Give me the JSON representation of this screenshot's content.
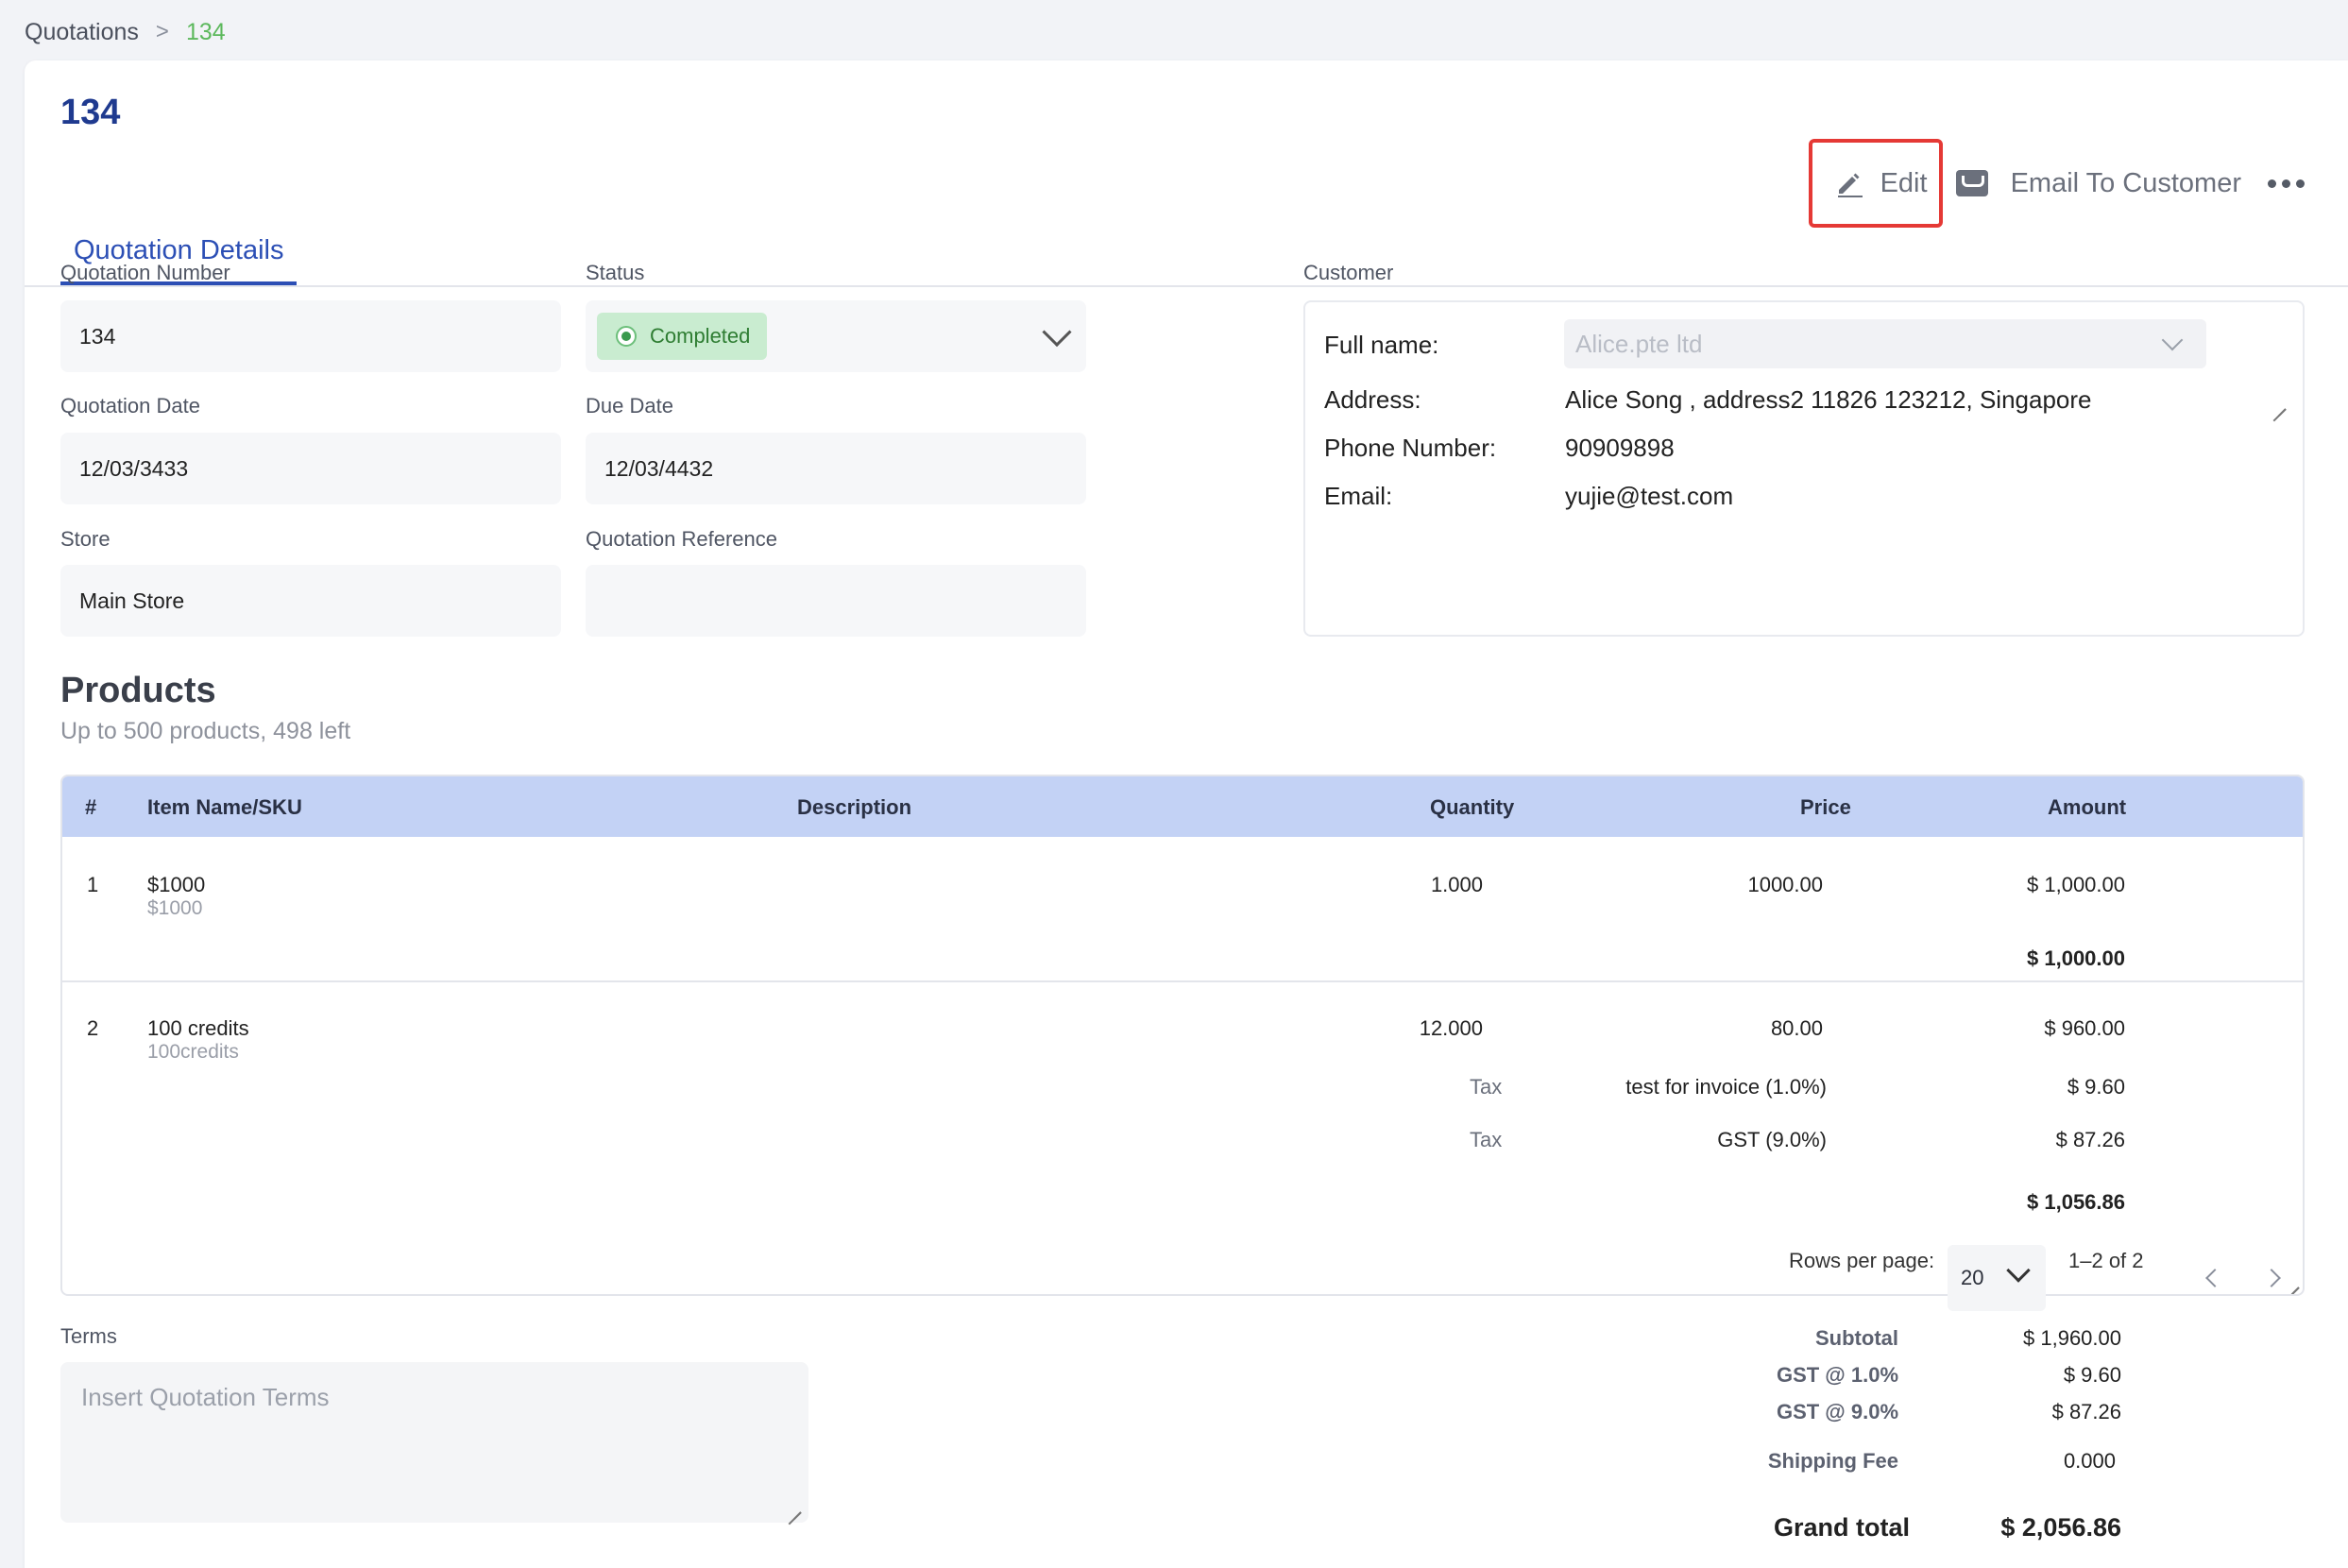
{
  "breadcrumb": {
    "root": "Quotations",
    "separator": ">",
    "current": "134"
  },
  "page": {
    "title": "134"
  },
  "tabs": {
    "active": "Quotation Details"
  },
  "actions": {
    "edit": "Edit",
    "email": "Email To Customer"
  },
  "form": {
    "quotation_number": {
      "label": "Quotation Number",
      "value": "134"
    },
    "status": {
      "label": "Status",
      "value": "Completed"
    },
    "quotation_date": {
      "label": "Quotation Date",
      "value": "12/03/3433"
    },
    "due_date": {
      "label": "Due Date",
      "value": "12/03/4432"
    },
    "store": {
      "label": "Store",
      "value": "Main Store"
    },
    "quotation_reference": {
      "label": "Quotation Reference",
      "value": ""
    }
  },
  "customer": {
    "label": "Customer",
    "full_name_label": "Full name:",
    "full_name_placeholder": "Alice.pte ltd",
    "address_label": "Address:",
    "address": "Alice Song , address2 11826 123212, Singapore",
    "phone_label": "Phone Number:",
    "phone": "90909898",
    "email_label": "Email:",
    "email": "yujie@test.com"
  },
  "products": {
    "title": "Products",
    "subtitle": "Up to 500 products, 498 left",
    "columns": [
      "#",
      "Item Name/SKU",
      "Description",
      "Quantity",
      "Price",
      "Amount"
    ],
    "rows": [
      {
        "index": "1",
        "name": "$1000",
        "sku": "$1000",
        "quantity": "1.000",
        "price": "1000.00",
        "amount": "$ 1,000.00",
        "total": "$ 1,000.00"
      },
      {
        "index": "2",
        "name": "100 credits",
        "sku": "100credits",
        "quantity": "12.000",
        "price": "80.00",
        "amount": "$ 960.00",
        "taxes": [
          {
            "label": "Tax",
            "name": "test for invoice (1.0%)",
            "amount": "$ 9.60"
          },
          {
            "label": "Tax",
            "name": "GST (9.0%)",
            "amount": "$ 87.26"
          }
        ],
        "total": "$ 1,056.86"
      }
    ]
  },
  "pagination": {
    "rows_per_page_label": "Rows per page:",
    "rows_per_page": "20",
    "range": "1–2 of 2"
  },
  "terms": {
    "label": "Terms",
    "placeholder": "Insert Quotation Terms"
  },
  "totals": {
    "subtotal_label": "Subtotal",
    "subtotal": "$ 1,960.00",
    "gst1_label": "GST @ 1.0%",
    "gst1": "$ 9.60",
    "gst9_label": "GST @ 9.0%",
    "gst9": "$ 87.26",
    "shipping_label": "Shipping Fee",
    "shipping": "0.000",
    "grand_label": "Grand total",
    "grand": "$ 2,056.86"
  },
  "colors": {
    "accent": "#2c4fb5",
    "status_bg": "#c9ecd0",
    "table_header": "#c3d2f5",
    "highlight": "#e53935"
  }
}
